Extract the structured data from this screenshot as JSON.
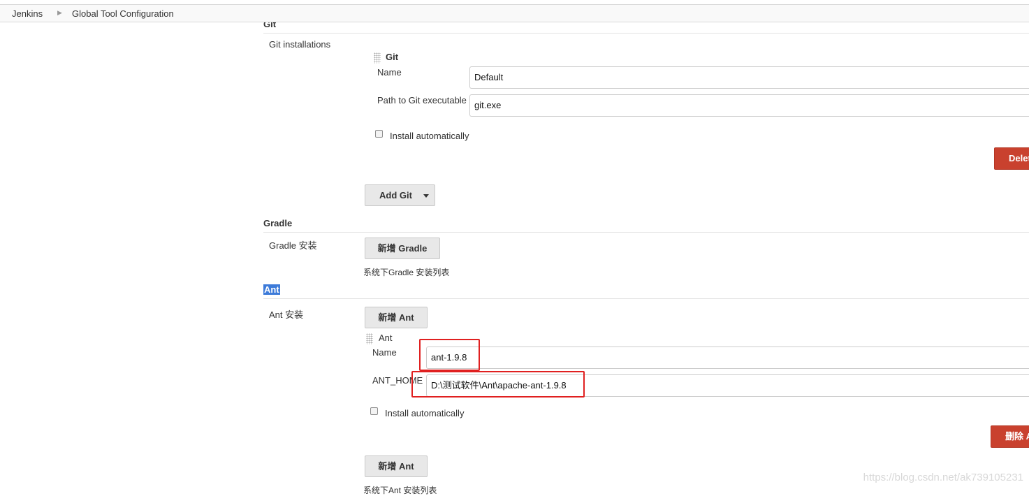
{
  "breadcrumb": {
    "root": "Jenkins",
    "page": "Global Tool Configuration"
  },
  "git": {
    "section_title": "Git",
    "installations_label": "Git installations",
    "item_title": "Git",
    "name_label": "Name",
    "name_value": "Default",
    "path_label": "Path to Git executable",
    "path_value": "git.exe",
    "install_auto_label": "Install automatically",
    "delete_label": "Delete Git",
    "add_label": "Add Git"
  },
  "gradle": {
    "section_title": "Gradle",
    "install_label": "Gradle 安装",
    "add_label": "新增 Gradle",
    "help_text": "系统下Gradle 安装列表"
  },
  "ant": {
    "section_title": "Ant",
    "install_label": "Ant 安装",
    "add_label": "新增 Ant",
    "item_title": "Ant",
    "name_label": "Name",
    "name_value": "ant-1.9.8",
    "home_label": "ANT_HOME",
    "home_value": "D:\\测试软件\\Ant\\apache-ant-1.9.8",
    "install_auto_label": "Install automatically",
    "delete_label": "删除 Ant",
    "add_label_bottom": "新增 Ant",
    "help_text": "系统下Ant 安装列表"
  },
  "watermark": "https://blog.csdn.net/ak739105231",
  "colors": {
    "delete": "#c9412e",
    "highlight": "#e02020",
    "selection": "#3d7bd9"
  }
}
